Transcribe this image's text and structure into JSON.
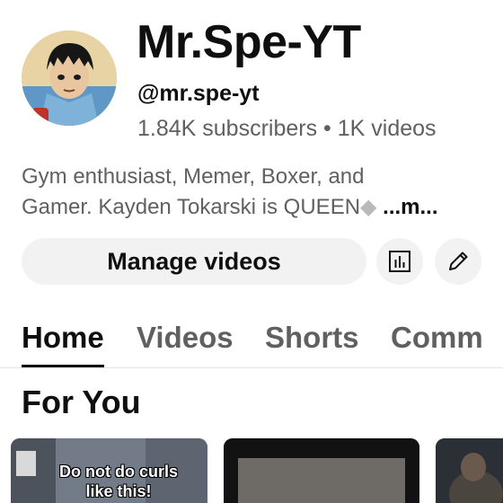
{
  "channel": {
    "name": "Mr.Spe-YT",
    "handle": "@mr.spe-yt",
    "stats": "1.84K subscribers • 1K videos",
    "description_line1": "Gym enthusiast, Memer, Boxer, and",
    "description_line2": "Gamer. Kayden Tokarski is QUEEN",
    "description_more": " ...m..."
  },
  "actions": {
    "manage_label": "Manage videos",
    "analytics_icon": "analytics-icon",
    "edit_icon": "pencil-icon"
  },
  "tabs": [
    {
      "label": "Home",
      "active": true
    },
    {
      "label": "Videos",
      "active": false
    },
    {
      "label": "Shorts",
      "active": false
    },
    {
      "label": "Comm",
      "active": false
    }
  ],
  "section": {
    "title": "For You"
  },
  "videos": [
    {
      "caption": "Do not do curls like this!"
    },
    {
      "caption": ""
    },
    {
      "caption": ""
    }
  ]
}
